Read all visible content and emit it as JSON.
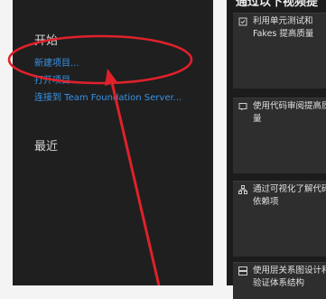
{
  "start_page": {
    "start": {
      "title": "开始",
      "links": [
        "新建项目...",
        "打开项目...",
        "连接到 Team Foundation Server..."
      ]
    },
    "recent": {
      "title": "最近"
    },
    "right": {
      "title": "通过以下视频提",
      "cards": [
        {
          "icon": "unit-test-icon",
          "text": "利用单元测试和 Fakes 提高质量"
        },
        {
          "icon": "code-review-icon",
          "text": "使用代码审阅提高质量"
        },
        {
          "icon": "visualize-icon",
          "text": "通过可视化了解代码依赖项"
        },
        {
          "icon": "layer-diagram-icon",
          "text": "使用层关系图设计和验证体系结构"
        }
      ]
    },
    "colors": {
      "link": "#3794e6",
      "annotation": "#e0212b"
    }
  }
}
